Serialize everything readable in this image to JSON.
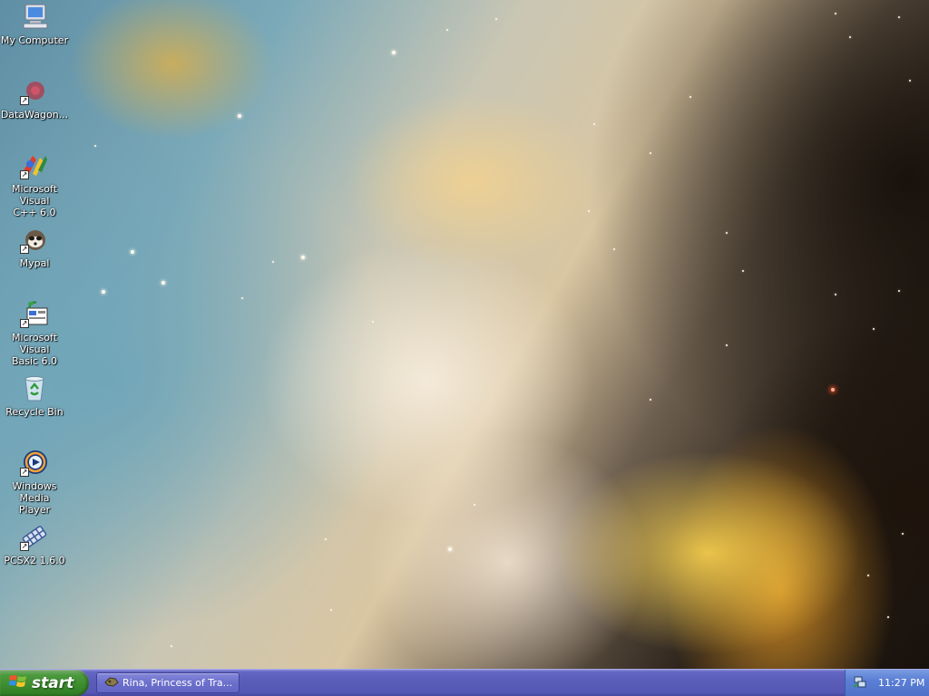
{
  "desktop": {
    "icons": [
      {
        "label": "My Computer",
        "icon": "my-computer-icon",
        "shortcut": false
      },
      {
        "label": "DataWagon...",
        "icon": "datawagon-icon",
        "shortcut": true
      },
      {
        "label": "Microsoft Visual\nC++ 6.0",
        "icon": "visual-cpp-icon",
        "shortcut": true
      },
      {
        "label": "Mypal",
        "icon": "mypal-icon",
        "shortcut": true
      },
      {
        "label": "Microsoft Visual\nBasic 6.0",
        "icon": "visual-basic-icon",
        "shortcut": true
      },
      {
        "label": "Recycle Bin",
        "icon": "recycle-bin-icon",
        "shortcut": false
      },
      {
        "label": "Windows Media\nPlayer",
        "icon": "media-player-icon",
        "shortcut": true
      },
      {
        "label": "PCSX2 1.6.0",
        "icon": "pcsx2-icon",
        "shortcut": true
      }
    ]
  },
  "taskbar": {
    "start_label": "start",
    "tasks": [
      {
        "label": "Rina, Princess of Tra...",
        "icon": "rina-app-icon"
      }
    ],
    "tray": {
      "network_icon": "network-status-icon",
      "clock": "11:27 PM"
    }
  },
  "colors": {
    "taskbar": "#5a5cb8",
    "start_button": "#3c8c2e",
    "tray": "#5b7fd6",
    "label_text": "#ffffff"
  }
}
